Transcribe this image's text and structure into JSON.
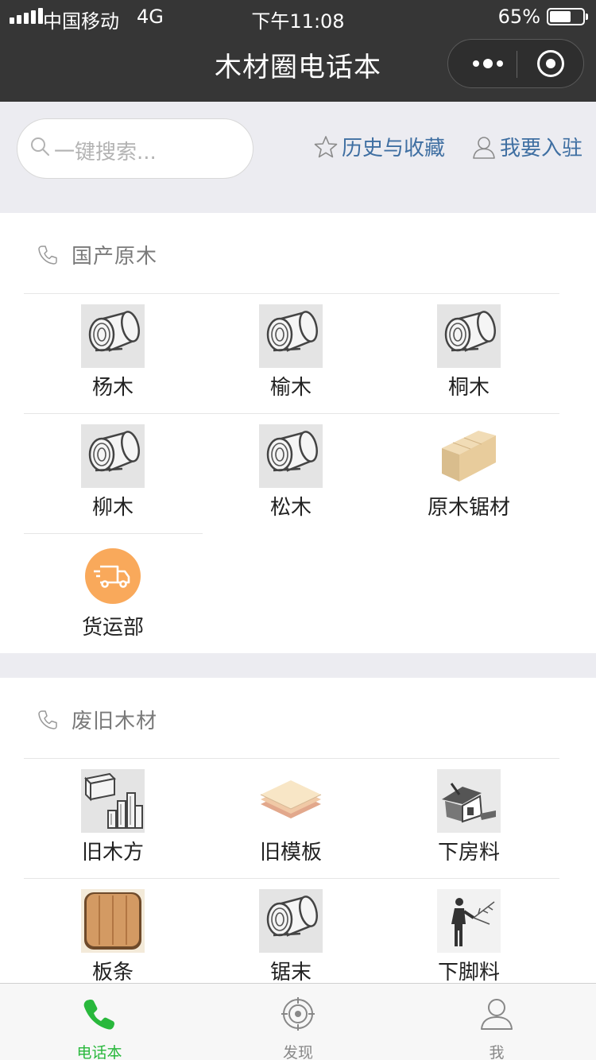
{
  "status_bar": {
    "carrier": "中国移动",
    "network": "4G",
    "time": "下午11:08",
    "battery": "65%",
    "battery_level": 0.65
  },
  "header": {
    "title": "木材圈电话本"
  },
  "search": {
    "placeholder": "一键搜索..."
  },
  "links": {
    "favorites": "历史与收藏",
    "join": "我要入驻"
  },
  "sections": [
    {
      "title": "国产原木",
      "items": [
        {
          "label": "杨木",
          "icon": "log-icon"
        },
        {
          "label": "榆木",
          "icon": "log-icon"
        },
        {
          "label": "桐木",
          "icon": "log-icon"
        },
        {
          "label": "柳木",
          "icon": "log-icon"
        },
        {
          "label": "松木",
          "icon": "log-icon"
        },
        {
          "label": "原木锯材",
          "icon": "lumber-block-icon"
        },
        {
          "label": "货运部",
          "icon": "truck-icon"
        }
      ]
    },
    {
      "title": "废旧木材",
      "items": [
        {
          "label": "旧木方",
          "icon": "stacked-timber-icon"
        },
        {
          "label": "旧模板",
          "icon": "board-stack-icon"
        },
        {
          "label": "下房料",
          "icon": "house-demolition-icon"
        },
        {
          "label": "板条",
          "icon": "wood-plank-icon"
        },
        {
          "label": "锯末",
          "icon": "log-icon"
        },
        {
          "label": "下脚料",
          "icon": "worker-branch-icon"
        }
      ]
    }
  ],
  "tabbar": [
    {
      "label": "电话本",
      "icon": "phone-icon",
      "active": true
    },
    {
      "label": "发现",
      "icon": "discover-icon",
      "active": false
    },
    {
      "label": "我",
      "icon": "user-icon",
      "active": false
    }
  ],
  "colors": {
    "header_bg": "#363636",
    "accent": "#29b83c",
    "link": "#3f6fa2",
    "truck_bg": "#f9a95b"
  }
}
